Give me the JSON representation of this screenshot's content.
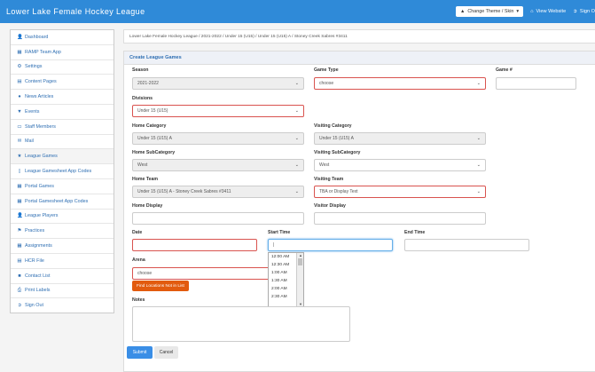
{
  "app": {
    "title": "Lower Lake Female Hockey League",
    "theme_button": "Change Theme / Skin",
    "view_website": "View Website",
    "sign_out": "Sign O"
  },
  "sidebar": {
    "items": [
      {
        "label": "Dashboard",
        "icon": "user-icon"
      },
      {
        "label": "RAMP Team App",
        "icon": "grid-icon"
      },
      {
        "label": "Settings",
        "icon": "gear-icon"
      },
      {
        "label": "Content Pages",
        "icon": "file-icon"
      },
      {
        "label": "News Articles",
        "icon": "globe-icon"
      },
      {
        "label": "Events",
        "icon": "filter-icon"
      },
      {
        "label": "Staff Members",
        "icon": "card-icon"
      },
      {
        "label": "Mail",
        "icon": "mail-icon"
      },
      {
        "label": "League Games",
        "icon": "star-icon"
      },
      {
        "label": "League Gamesheet App Codes",
        "icon": "mobile-icon"
      },
      {
        "label": "Portal Games",
        "icon": "grid-icon"
      },
      {
        "label": "Portal Gamesheet App Codes",
        "icon": "grid-icon"
      },
      {
        "label": "League Players",
        "icon": "user-icon"
      },
      {
        "label": "Practices",
        "icon": "flag-icon"
      },
      {
        "label": "Assignments",
        "icon": "table-icon"
      },
      {
        "label": "HCR File",
        "icon": "file-icon"
      },
      {
        "label": "Contact List",
        "icon": "comment-icon"
      },
      {
        "label": "Print Labels",
        "icon": "print-icon"
      },
      {
        "label": "Sign Out",
        "icon": "signout-icon"
      }
    ]
  },
  "breadcrumb": "Lower Lake Female Hockey League  /  2021-2022  /  Under 15 (U15)  /  Under 15 (U15) A  /  Stoney Creek Sabres #3411",
  "form": {
    "heading": "Create League Games",
    "season_label": "Season",
    "season_value": "2021-2022",
    "game_type_label": "Game Type",
    "game_type_value": "choose",
    "game_num_label": "Game #",
    "divisions_label": "Divisions",
    "divisions_value": "Under 15 (U15)",
    "home_category_label": "Home Category",
    "home_category_value": "Under 15 (U15) A",
    "visiting_category_label": "Visiting Category",
    "visiting_category_value": "Under 15 (U15) A",
    "home_subcategory_label": "Home SubCategory",
    "home_subcategory_value": "West",
    "visiting_subcategory_label": "Visiting SubCategory",
    "visiting_subcategory_value": "West",
    "home_team_label": "Home Team",
    "home_team_value": "Under 15 (U15) A - Stoney Creek Sabres #3411",
    "visiting_team_label": "Visiting Team",
    "visiting_team_value": "TBA or Display Text",
    "home_display_label": "Home Display",
    "visitor_display_label": "Visitor Display",
    "date_label": "Date",
    "start_time_label": "Start Time",
    "end_time_label": "End Time",
    "start_time_value": "|",
    "arena_label": "Arena",
    "arena_value": "choose",
    "find_locations_label": "Find Locations Not in List",
    "notes_label": "Notes",
    "time_options": [
      "12:00 AM",
      "12:30 AM",
      "1:00 AM",
      "1:30 AM",
      "2:00 AM",
      "2:30 AM"
    ],
    "submit_label": "Submit",
    "cancel_label": "Cancel"
  }
}
